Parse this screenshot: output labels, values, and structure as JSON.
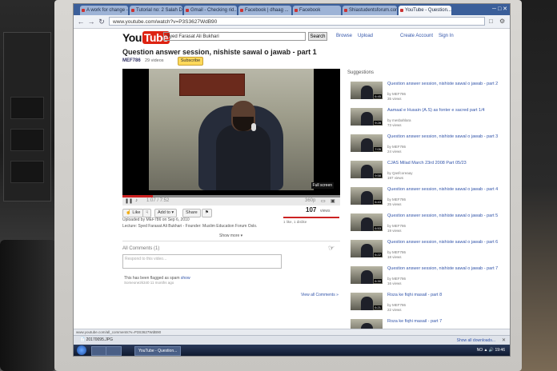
{
  "browser": {
    "tabs": [
      {
        "label": "A work for change -"
      },
      {
        "label": "Tutorial no: 2 Salah Di..."
      },
      {
        "label": "Gmail - Checking rid..."
      },
      {
        "label": "Facebook | dhaag ..."
      },
      {
        "label": "Facebook"
      },
      {
        "label": "Shiastudentsforum.com"
      },
      {
        "label": "YouTube - Question..."
      }
    ],
    "url": "www.youtube.com/watch?v=P3S3627WdB90",
    "status_url": "www.youtube.com/all_comments?v=P3S3627WdB90"
  },
  "header": {
    "logo_you": "You",
    "logo_tube": "Tube",
    "search_value": "Syed Farasat Ali Bukhari",
    "search_button": "Search",
    "links": [
      "Browse",
      "Upload",
      "Create Account",
      "Sign In"
    ]
  },
  "video": {
    "title": "Question answer session, nishiste sawal o jawab - part 1",
    "channel": "MEF786",
    "video_count": "29 videos",
    "subscribe_label": "Subscribe",
    "time": "1:07 / 7:52",
    "quality": "360p",
    "progress": 0.14,
    "fullscreen_label": "Full screen",
    "like_label": "Like",
    "add_label": "Add to",
    "share_label": "Share",
    "views": "107",
    "views_label": "views",
    "likes_text": "1 like, 1 dislike",
    "uploaded": "Uploaded by MEF786 on Sep 6, 2010",
    "description": "Lecture: Syed Farasat Ali Bukhari - Founder: Muslim Education Forum Oslo.",
    "show_more": "Show more"
  },
  "comments": {
    "heading": "All Comments (1)",
    "placeholder": "Respond to this video...",
    "flagged_text": "This has been flagged as spam",
    "flagged_action": "show",
    "flagged_meta": "Someone2k340 11 months ago",
    "view_all": "View all Comments »"
  },
  "suggestions": {
    "heading": "Suggestions",
    "items": [
      {
        "title": "Question answer session, nishiste sawal o jawab - part 2",
        "by": "by MEF786",
        "views": "35 views",
        "duration": "6:45"
      },
      {
        "title": "Aamaal e Husain (A.S) as fonter e sacred part 1/4",
        "by": "by mesbahlara",
        "views": "73 views",
        "duration": "9:28"
      },
      {
        "title": "Question answer session, nishiste sawal o jawab - part 3",
        "by": "by MEF786",
        "views": "24 views",
        "duration": "7:05"
      },
      {
        "title": "CJAS Milad March 23rd 2008 Part 05/23",
        "by": "by Qasfcoreaay",
        "views": "197 views",
        "duration": "9:58"
      },
      {
        "title": "Question answer session, nishiste sawal o jawab - part 4",
        "by": "by MEF786",
        "views": "25 views",
        "duration": "6:43"
      },
      {
        "title": "Question answer session, nishiste sawal o jawab - part 5",
        "by": "by MEF786",
        "views": "19 views",
        "duration": "6:53"
      },
      {
        "title": "Question answer session, nishiste sawal o jawab - part 6",
        "by": "by MEF786",
        "views": "18 views",
        "duration": "6:22"
      },
      {
        "title": "Question answer session, nishiste sawal o jawab - part 7",
        "by": "by MEF786",
        "views": "16 views",
        "duration": "6:30"
      },
      {
        "title": "Roza ke fiqhi masail - part 8",
        "by": "by MEF786",
        "views": "22 views",
        "duration": "6:21"
      },
      {
        "title": "Roza ke fiqhi masail - part 7",
        "by": "",
        "views": "",
        "duration": ""
      }
    ]
  },
  "downloads": {
    "item": "20170095.JPG",
    "show_all": "Show all downloads..."
  },
  "taskbar": {
    "task": "YouTube - Question...",
    "lang": "NO",
    "clock": "19:46"
  }
}
